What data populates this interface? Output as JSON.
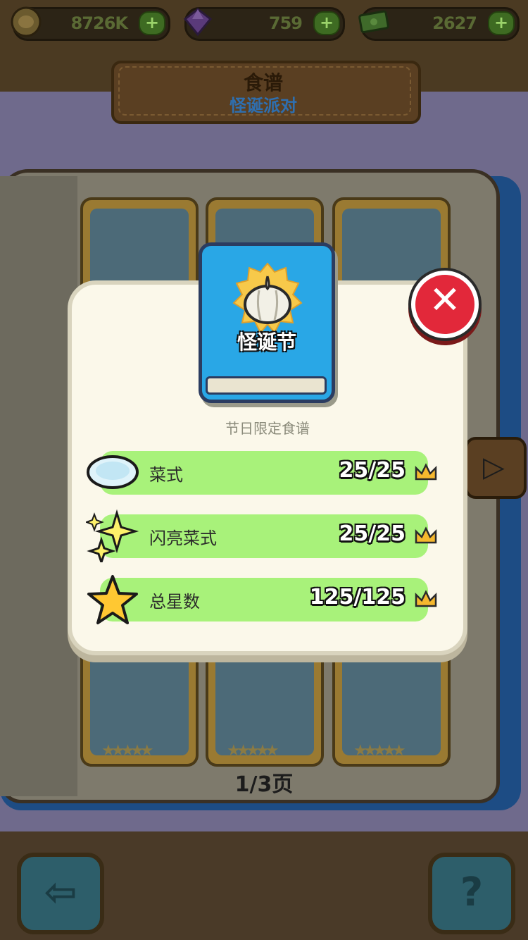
{
  "resources": [
    {
      "icon": "bread-coin-icon",
      "value": "8726K"
    },
    {
      "icon": "gem-icon",
      "value": "759"
    },
    {
      "icon": "cash-icon",
      "value": "2627"
    }
  ],
  "plus_label": "+",
  "header": {
    "title": "食谱",
    "subtitle": "怪诞派对"
  },
  "book": {
    "page_counter": "1/3页"
  },
  "modal": {
    "badge_label": "怪诞节",
    "badge_icon": "garlic-icon",
    "subtitle": "节日限定食谱",
    "rows": [
      {
        "icon": "plate-icon",
        "label": "菜式",
        "value": "25/25"
      },
      {
        "icon": "sparkle-icon",
        "label": "闪亮菜式",
        "value": "25/25"
      },
      {
        "icon": "star-icon",
        "label": "总星数",
        "value": "125/125"
      }
    ],
    "close_label": "✕"
  },
  "nav": {
    "back_icon": "back-arrow-icon",
    "help_label": "?",
    "next_icon": "next-arrow-icon"
  },
  "colors": {
    "row_green": "#a8f27a",
    "close_red": "#e2283a",
    "badge_blue": "#29a7e6"
  }
}
